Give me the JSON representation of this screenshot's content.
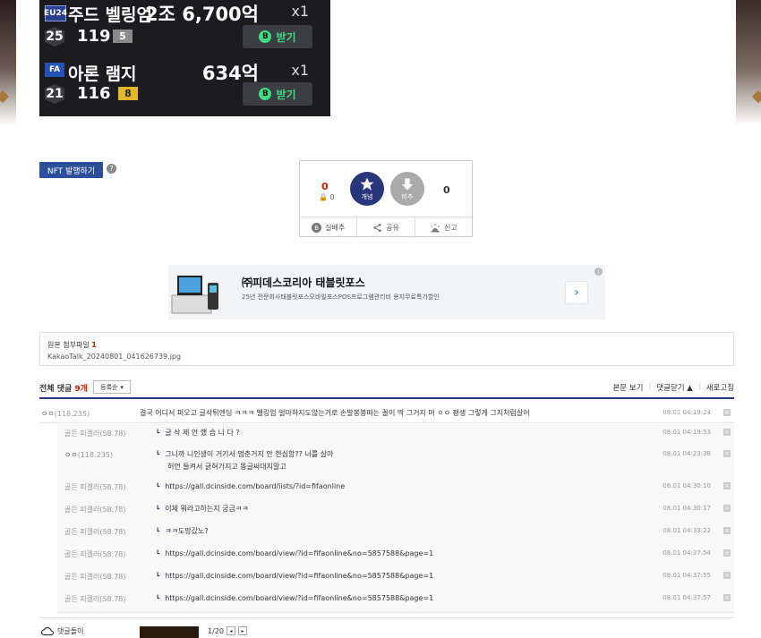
{
  "colors": {
    "accent": "#29367c",
    "nft": "#2d4e9c",
    "red": "#d31900",
    "green": "#3ddc84"
  },
  "players": [
    {
      "season": "EU24",
      "season_color": "#2a3f8f",
      "name": "주드 벨링엄",
      "price": "2조 6,700억",
      "mult": "x1",
      "level": "25",
      "ovr": "119",
      "grade": "5",
      "grade_color": "#8a8a8a",
      "grade_text": "#fff",
      "action": "받기",
      "coin": "B"
    },
    {
      "season": "FA",
      "season_color": "#2451b8",
      "name": "아론 램지",
      "price": "634억",
      "mult": "x1",
      "level": "21",
      "ovr": "116",
      "grade": "8",
      "grade_color": "#e3b826",
      "grade_text": "#222",
      "action": "받기",
      "coin": "B"
    }
  ],
  "nft": {
    "label": "NFT 발행하기",
    "help": "?"
  },
  "vote": {
    "up_count": "0",
    "up_sub": "0",
    "up_label": "개념",
    "down_label": "비추",
    "down_count": "0",
    "actions": [
      {
        "icon": "B",
        "label": "실베추"
      },
      {
        "icon": "share-icon",
        "label": "공유"
      },
      {
        "icon": "siren-icon",
        "label": "신고"
      }
    ]
  },
  "ad": {
    "title": "㈜피데스코리아 태블릿포스",
    "subtitle": "25년 전문회사태블릿포스모바일포스POS프로그램관리비 용지무료특가할인",
    "arrow": "›",
    "info": "i"
  },
  "attach": {
    "title": "원본 첨부파일",
    "count": "1",
    "file": "KakaoTalk_20240801_041626739.jpg"
  },
  "comments_header": {
    "label": "전체 댓글",
    "count": "9개",
    "sort": "등록순",
    "links": [
      "본문 보기",
      "댓글닫기 ▲",
      "새로고침"
    ]
  },
  "comments": [
    {
      "nick": "ㅇㅇ",
      "ip": "(118.235)",
      "text": "결국 어디서 퍼오고 글삭튀엔딩 ㅋㅋㅋ 벨링엄 얼마하지도않는거로 손발봉봉떠는 꼴이 딱 그거지 머 ㅇㅇ 평생 그렇게 그지처럼살어",
      "date": "08.01 04:19:24",
      "del": "×"
    },
    {
      "nick": "골든 피겔러",
      "ip": "(58.78)",
      "text": "글 삭 제 안 했 습 니 다 ?",
      "date": "08.01 04:19:53",
      "del": "×"
    },
    {
      "nick": "ㅇㅇ",
      "ip": "(118.235)",
      "text": "그니까 니인생이 거기서 멈춘거지 안 한심함?? 너를 살아",
      "text2": "허언 들켜서 긁혀가지고 똥글싸대지말고",
      "date": "08.01 04:23:38",
      "del": "×"
    },
    {
      "nick": "골든 피겔러",
      "ip": "(58.78)",
      "text": "https://gall.dcinside.com/board/lists/?id=fifaonline",
      "date": "08.01 04:30:10",
      "del": "×"
    },
    {
      "nick": "골든 피겔러",
      "ip": "(58.78)",
      "text": "이제 뭐라고하는지 궁금ㅋㅋ",
      "date": "08.01 04:30:17",
      "del": "×"
    },
    {
      "nick": "골든 피겔러",
      "ip": "(58.78)",
      "text": "ㅋㅋ도망갔노?",
      "date": "08.01 04:33:22",
      "del": "×"
    },
    {
      "nick": "골든 피겔러",
      "ip": "(58.78)",
      "text": "https://gall.dcinside.com/board/view/?id=fifaonline&no=5857588&page=1",
      "date": "08.01 04:37:54",
      "del": "×"
    },
    {
      "nick": "골든 피겔러",
      "ip": "(58.78)",
      "text": "https://gall.dcinside.com/board/view/?id=fifaonline&no=5857588&page=1",
      "date": "08.01 04:37:55",
      "del": "×"
    },
    {
      "nick": "골든 피겔러",
      "ip": "(58.78)",
      "text": "https://gall.dcinside.com/board/view/?id=fifaonline&no=5857588&page=1",
      "date": "08.01 04:37:57",
      "del": "×"
    }
  ],
  "bottom": {
    "label": "댓글돌이",
    "pager": "1/20",
    "prev": "◂",
    "next": "▸"
  }
}
